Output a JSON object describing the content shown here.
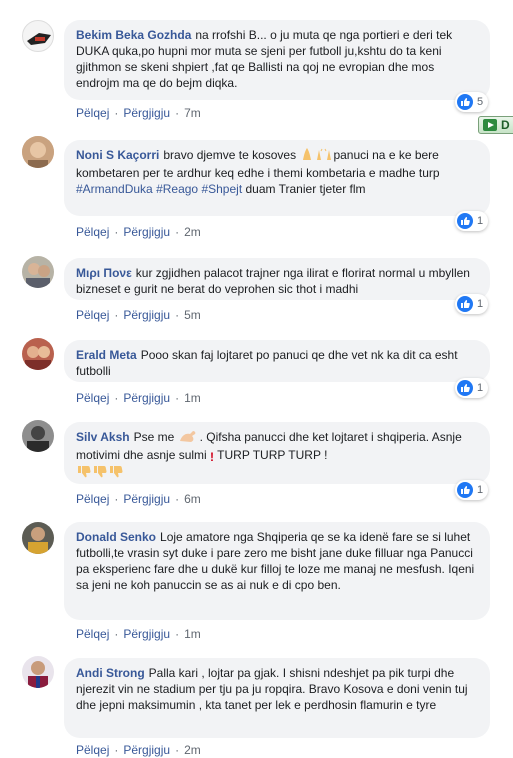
{
  "actions": {
    "like": "Pëlqej",
    "reply": "Përgjigju"
  },
  "side_button": {
    "label": "D"
  },
  "comments": [
    {
      "author": "Bekim Beka Gozhda",
      "text": "na rrofshi B... o ju muta qe nga portieri e deri tek DUKA quka,po hupni mor muta se sjeni per futboll ju,kshtu do ta keni gjithmon se skeni shpiert ,fat qe Ballisti na qoj ne evropian dhe mos endrojm ma qe do bejm diqka.",
      "time": "7m",
      "reactions": "5"
    },
    {
      "author": "Noni S Kaçorri",
      "text_parts": [
        "bravo djemve te kosoves ",
        "panuci na e ke bere kombetaren per te ardhur keq edhe i themi kombetaria e madhe turp "
      ],
      "hashtags": [
        "#ArmandDuka",
        "#Reago",
        "#Shpejt"
      ],
      "text_after": " duam Tranier tjeter flm",
      "time": "2m",
      "reactions": "1"
    },
    {
      "author": "Μιρι Πονε",
      "text": "kur zgjidhen palacot trajner nga ilirat e florirat normal u mbyllen bizneset e gurit ne berat do veprohen sic thot i madhi",
      "time": "5m",
      "reactions": "1"
    },
    {
      "author": "Erald Meta",
      "text": "Pooo skan faj lojtaret po panuci qe dhe vet nk ka dit ca esht futbolli",
      "time": "1m",
      "reactions": "1"
    },
    {
      "author": "Silv Aksh",
      "text_a": "Pse me ",
      "text_b": ". Qifsha panucci dhe ket lojtaret i shqiperia. Asnje motivimi dhe asnje sulmi ",
      "text_c": " TURP TURP TURP !",
      "time": "6m",
      "reactions": "1"
    },
    {
      "author": "Donald Senko",
      "text": "Loje amatore nga Shqiperia qe se ka idenë fare se si luhet futbolli,te vrasin syt duke i pare zero me bisht jane duke filluar nga Panucci pa eksperienc fare dhe u dukë kur filloj te loze me manaj ne mesfush. Iqeni sa jeni ne koh panuccin se as ai nuk e di cpo ben.",
      "time": "1m"
    },
    {
      "author": "Andi Strong",
      "text": "Palla kari , lojtar pa gjak. I shisni ndeshjet pa pik turpi dhe njerezit vin ne stadium per tju pa ju ropqira. Bravo Kosova e doni venin tuj dhe jepni maksimumin , kta tanet per lek e perdhosin flamurin e tyre",
      "time": "2m"
    }
  ]
}
